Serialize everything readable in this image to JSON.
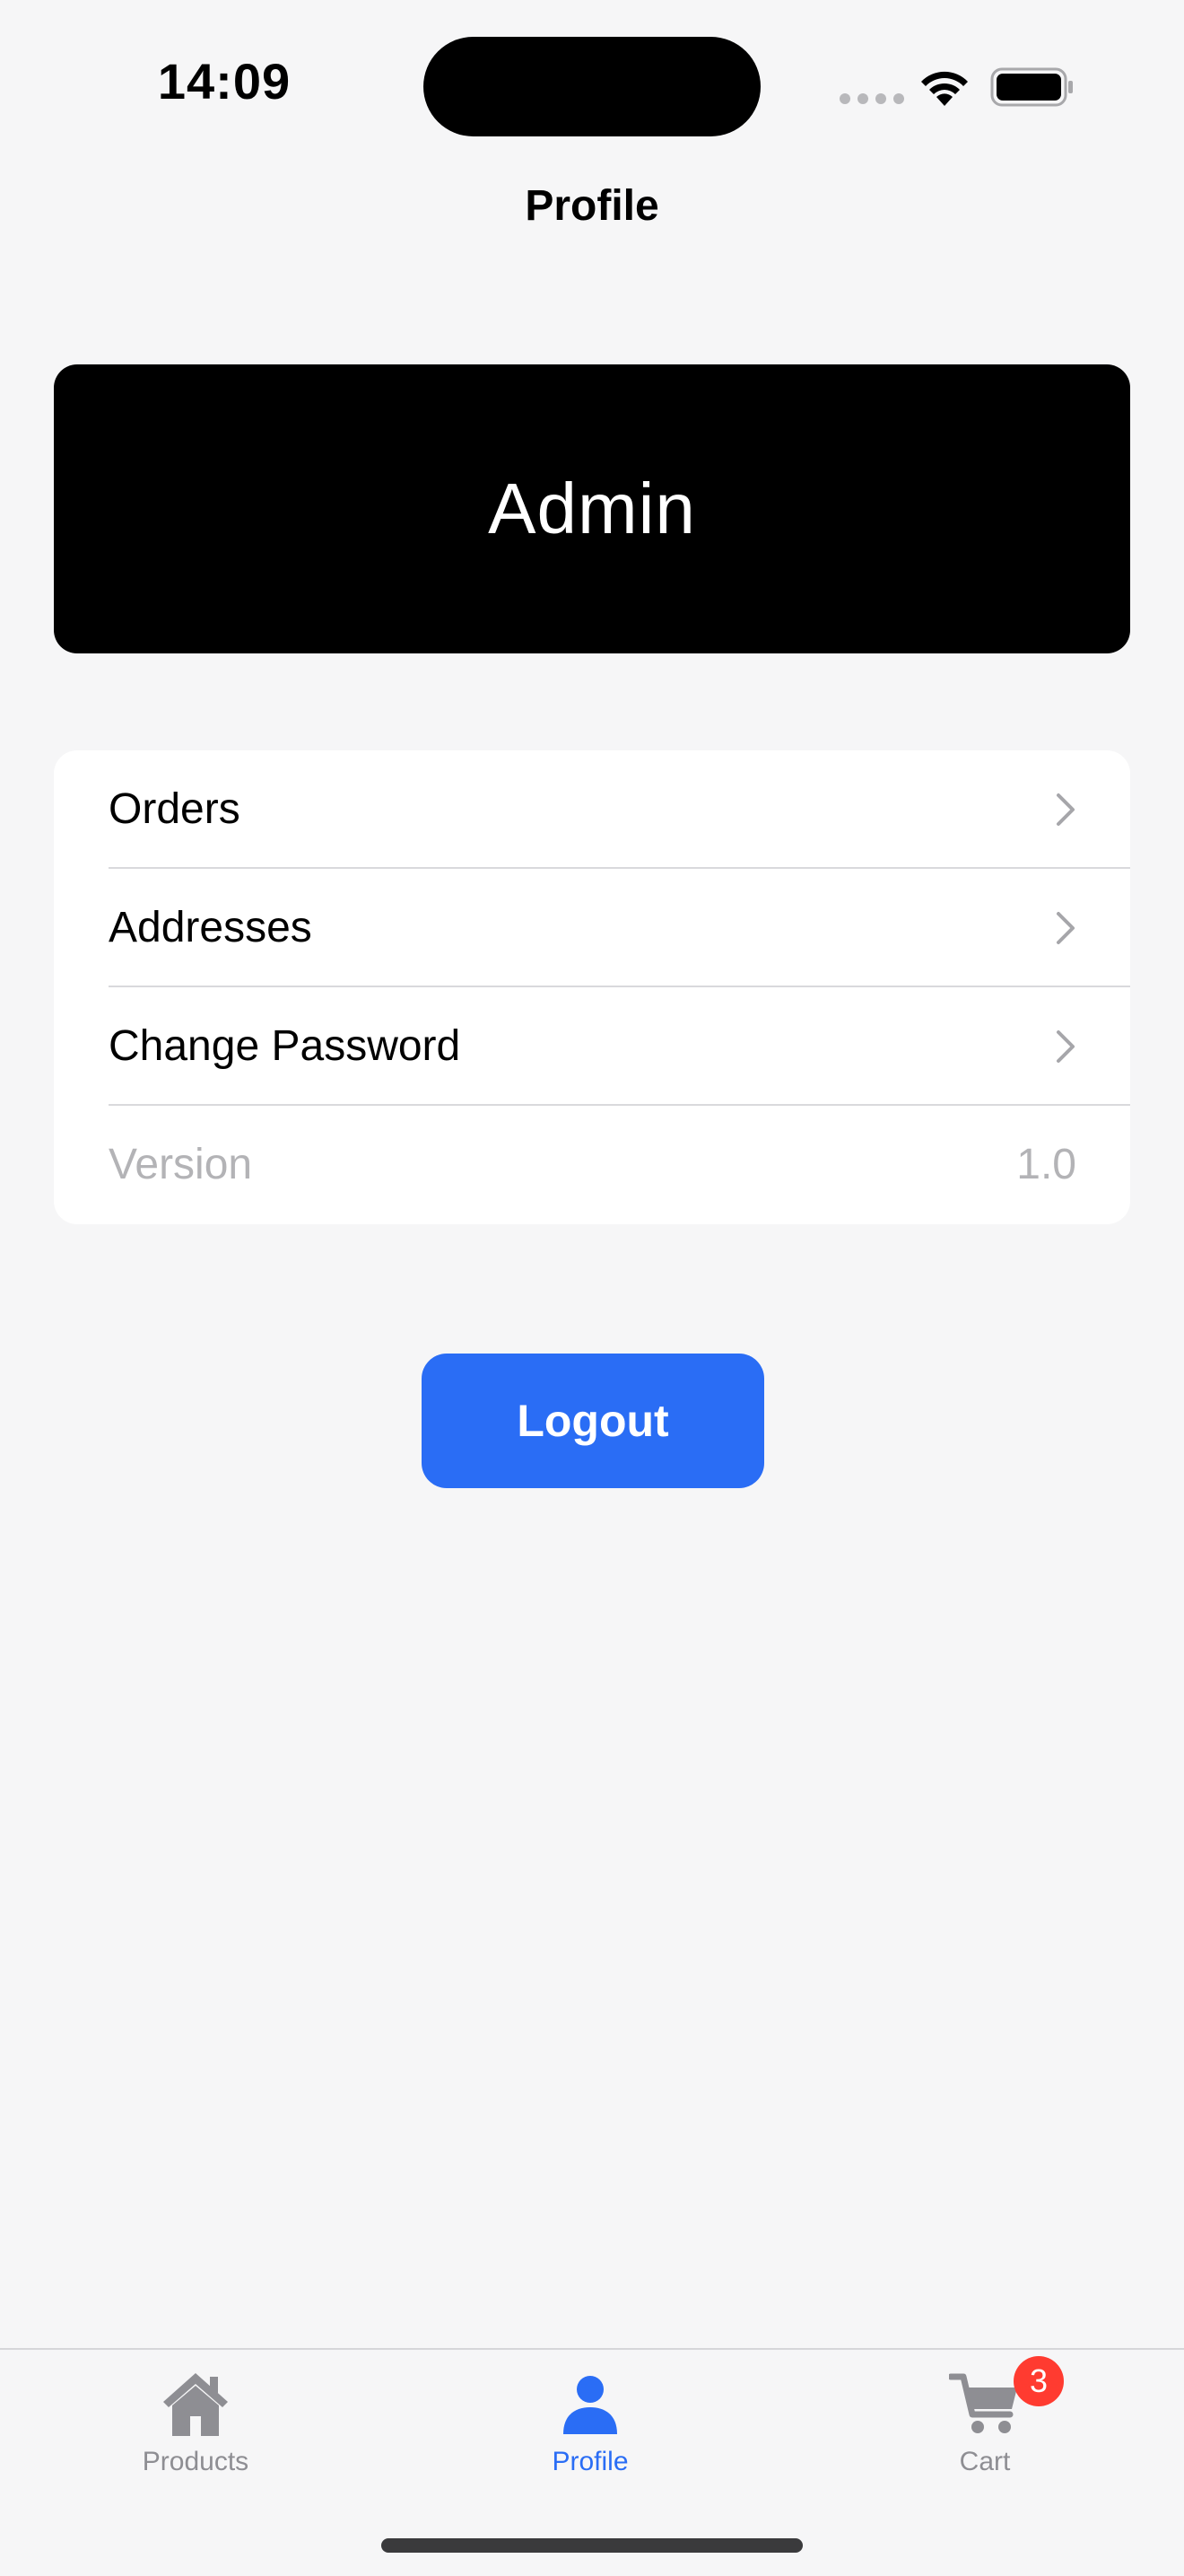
{
  "status_bar": {
    "time": "14:09"
  },
  "header": {
    "title": "Profile"
  },
  "profile_card": {
    "name": "Admin"
  },
  "menu": {
    "items": [
      {
        "label": "Orders",
        "icon": "chevron-right-icon"
      },
      {
        "label": "Addresses",
        "icon": "chevron-right-icon"
      },
      {
        "label": "Change Password",
        "icon": "chevron-right-icon"
      }
    ],
    "version": {
      "label": "Version",
      "value": "1.0"
    }
  },
  "logout": {
    "label": "Logout"
  },
  "tab_bar": {
    "tabs": [
      {
        "label": "Products",
        "icon": "home-icon"
      },
      {
        "label": "Profile",
        "icon": "person-icon",
        "active": true
      },
      {
        "label": "Cart",
        "icon": "cart-icon",
        "badge": "3"
      }
    ]
  },
  "colors": {
    "accent": "#2a6df5",
    "badge": "#ff3b30",
    "background": "#f6f6f7",
    "inactive": "#8e8e93"
  }
}
